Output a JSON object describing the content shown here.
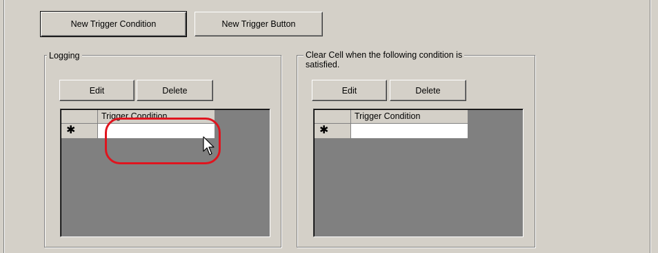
{
  "toolbar": {
    "new_trigger_condition_label": "New Trigger Condition",
    "new_trigger_button_label": "New Trigger Button"
  },
  "logging_group": {
    "title": "Logging",
    "edit_label": "Edit",
    "delete_label": "Delete",
    "grid": {
      "column_header": "Trigger Condition",
      "new_row_marker": "✱",
      "cell_value": ""
    }
  },
  "clear_group": {
    "title_line1": "Clear Cell when the following condition is",
    "title_line2": "satisfied.",
    "edit_label": "Edit",
    "delete_label": "Delete",
    "grid": {
      "column_header": "Trigger Condition",
      "new_row_marker": "✱",
      "cell_value": ""
    }
  },
  "annotation": {
    "highlight_color": "#e0141e",
    "cursor_icon": "arrow-cursor-icon"
  }
}
